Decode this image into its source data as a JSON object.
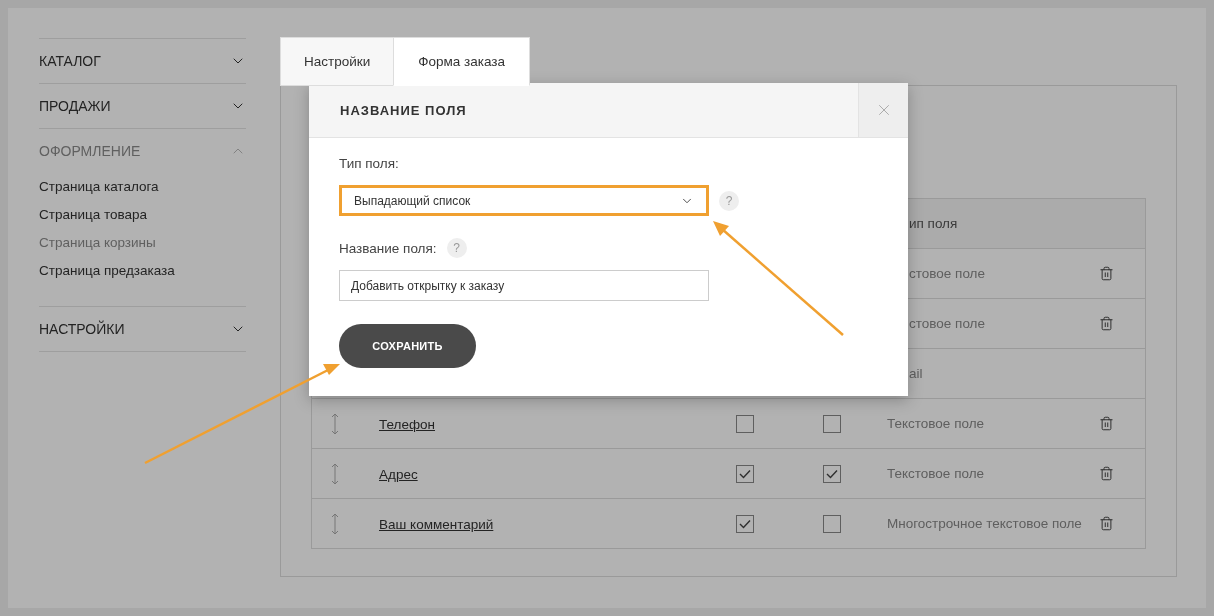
{
  "sidebar": {
    "sections": [
      {
        "label": "КАТАЛОГ",
        "expanded": false
      },
      {
        "label": "ПРОДАЖИ",
        "expanded": false
      },
      {
        "label": "ОФОРМЛЕНИЕ",
        "expanded": true,
        "children": [
          {
            "label": "Страница каталога",
            "selected": false
          },
          {
            "label": "Страница товара",
            "selected": false
          },
          {
            "label": "Страница корзины",
            "selected": true
          },
          {
            "label": "Страница предзаказа",
            "selected": false
          }
        ]
      },
      {
        "label": "НАСТРОЙКИ",
        "expanded": false
      }
    ]
  },
  "tabs": [
    {
      "label": "Настройки",
      "selected": false
    },
    {
      "label": "Форма заказа",
      "selected": true
    }
  ],
  "table": {
    "header_visible": "ип поля",
    "rows": [
      {
        "kind": "partial",
        "type": "стовое поле",
        "deletable": true
      },
      {
        "kind": "partial",
        "type": "стовое поле",
        "deletable": true
      },
      {
        "kind": "partial",
        "type": "ail",
        "deletable": false
      },
      {
        "kind": "full",
        "name": "Телефон",
        "checks": [
          false,
          false
        ],
        "type": "Текстовое поле",
        "deletable": true
      },
      {
        "kind": "full",
        "name": "Адрес",
        "checks": [
          true,
          true
        ],
        "type": "Текстовое поле",
        "deletable": true
      },
      {
        "kind": "full",
        "name": "Ваш комментарий",
        "checks": [
          true,
          false
        ],
        "type": "Многострочное текстовое поле",
        "deletable": true
      }
    ]
  },
  "modal": {
    "title": "НАЗВАНИЕ ПОЛЯ",
    "fields": [
      {
        "kind": "select",
        "label": "Тип поля:",
        "value": "Выпадающий список",
        "help": "?",
        "highlighted": true
      },
      {
        "kind": "text",
        "label": "Название поля:",
        "value": "Добавить открытку к заказу",
        "help": "?",
        "highlighted": false
      }
    ],
    "button": "СОХРАНИТЬ"
  }
}
